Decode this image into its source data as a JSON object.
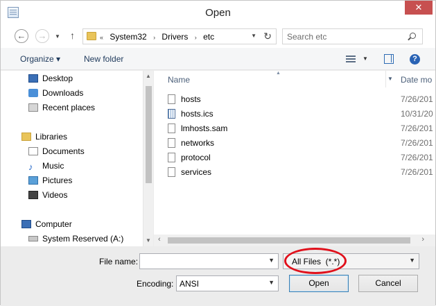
{
  "window": {
    "title": "Open",
    "close_glyph": "✕"
  },
  "nav": {
    "back_glyph": "←",
    "forward_glyph": "→",
    "up_glyph": "↑",
    "refresh_glyph": "↻",
    "breadcrumb": {
      "overflow": "«",
      "parts": [
        "System32",
        "Drivers",
        "etc"
      ],
      "separator": "›"
    },
    "search_placeholder": "Search etc"
  },
  "toolbar": {
    "organize": "Organize ▾",
    "new_folder": "New folder",
    "help": "?"
  },
  "sidebar": {
    "favorites": [
      {
        "label": "Desktop",
        "icon": "desktop-icon"
      },
      {
        "label": "Downloads",
        "icon": "downloads-icon"
      },
      {
        "label": "Recent places",
        "icon": "recent-places-icon"
      }
    ],
    "libraries": {
      "label": "Libraries",
      "items": [
        {
          "label": "Documents",
          "icon": "documents-icon"
        },
        {
          "label": "Music",
          "icon": "music-icon"
        },
        {
          "label": "Pictures",
          "icon": "pictures-icon"
        },
        {
          "label": "Videos",
          "icon": "videos-icon"
        }
      ]
    },
    "computer": {
      "label": "Computer",
      "items": [
        {
          "label": "System Reserved (A:)",
          "icon": "drive-icon"
        }
      ]
    }
  },
  "files": {
    "columns": {
      "name": "Name",
      "date": "Date mo"
    },
    "rows": [
      {
        "name": "hosts",
        "date": "7/26/201",
        "icon": "file-icon"
      },
      {
        "name": "hosts.ics",
        "date": "10/31/20",
        "icon": "calendar-file-icon"
      },
      {
        "name": "lmhosts.sam",
        "date": "7/26/201",
        "icon": "file-icon"
      },
      {
        "name": "networks",
        "date": "7/26/201",
        "icon": "file-icon"
      },
      {
        "name": "protocol",
        "date": "7/26/201",
        "icon": "file-icon"
      },
      {
        "name": "services",
        "date": "7/26/201",
        "icon": "file-icon"
      }
    ]
  },
  "footer": {
    "file_name_label": "File name:",
    "file_name_value": "",
    "file_type": "All Files  (*.*)",
    "encoding_label": "Encoding:",
    "encoding_value": "ANSI",
    "open_label": "Open",
    "cancel_label": "Cancel",
    "annotation_color": "#e0101b"
  }
}
